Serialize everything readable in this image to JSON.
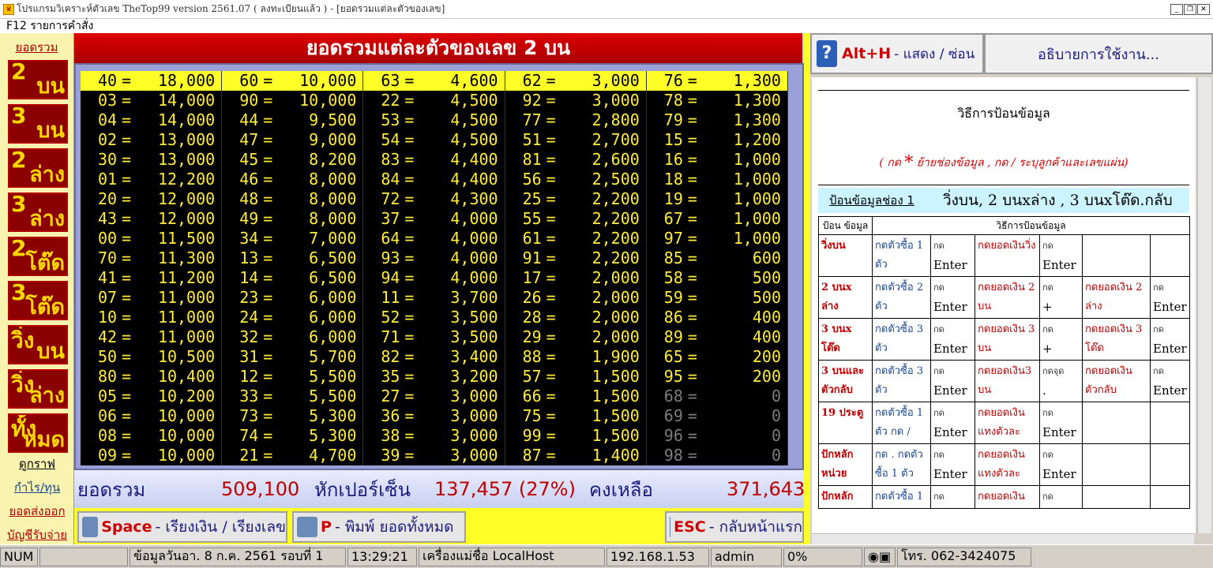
{
  "window": {
    "title": "โปรแกรมวิเคราะห์ตัวเลข TheTop99  version 2561.07  ( ลงทะเบียนแล้ว ) - [ยอดรวมแต่ละตัวของเลข]"
  },
  "menu": {
    "f12": "F12 รายการคำสั่ง"
  },
  "nav": {
    "top": "ยอดรวม",
    "buttons": [
      {
        "num": "2",
        "label": "บน"
      },
      {
        "num": "3",
        "label": "บน"
      },
      {
        "num": "2",
        "label": "ล่าง"
      },
      {
        "num": "3",
        "label": "ล่าง"
      },
      {
        "num": "2",
        "label": "โต๊ด"
      },
      {
        "num": "3",
        "label": "โต๊ด"
      },
      {
        "num": "วิ่ง",
        "label": "บน"
      },
      {
        "num": "วิ่ง",
        "label": "ล่าง"
      },
      {
        "num": "ทั้ง",
        "label": "หมด"
      }
    ],
    "links": [
      "ดูกราฟ",
      "กำไร/ทุน",
      "ยอดส่งออก",
      "บัญชีรับจ่าย"
    ]
  },
  "center": {
    "header": "ยอดรวมแต่ละตัวของเลข 2 บน"
  },
  "grid": {
    "columns": [
      [
        [
          "40",
          "18,000"
        ],
        [
          "03",
          "14,000"
        ],
        [
          "04",
          "14,000"
        ],
        [
          "02",
          "13,000"
        ],
        [
          "30",
          "13,000"
        ],
        [
          "01",
          "12,200"
        ],
        [
          "20",
          "12,000"
        ],
        [
          "43",
          "12,000"
        ],
        [
          "00",
          "11,500"
        ],
        [
          "70",
          "11,300"
        ],
        [
          "41",
          "11,200"
        ],
        [
          "07",
          "11,000"
        ],
        [
          "10",
          "11,000"
        ],
        [
          "42",
          "11,000"
        ],
        [
          "50",
          "10,500"
        ],
        [
          "80",
          "10,400"
        ],
        [
          "05",
          "10,200"
        ],
        [
          "06",
          "10,000"
        ],
        [
          "08",
          "10,000"
        ],
        [
          "09",
          "10,000"
        ]
      ],
      [
        [
          "60",
          "10,000"
        ],
        [
          "90",
          "10,000"
        ],
        [
          "44",
          "9,500"
        ],
        [
          "47",
          "9,000"
        ],
        [
          "45",
          "8,200"
        ],
        [
          "46",
          "8,000"
        ],
        [
          "48",
          "8,000"
        ],
        [
          "49",
          "8,000"
        ],
        [
          "34",
          "7,000"
        ],
        [
          "13",
          "6,500"
        ],
        [
          "14",
          "6,500"
        ],
        [
          "23",
          "6,000"
        ],
        [
          "24",
          "6,000"
        ],
        [
          "32",
          "6,000"
        ],
        [
          "31",
          "5,700"
        ],
        [
          "12",
          "5,500"
        ],
        [
          "33",
          "5,500"
        ],
        [
          "73",
          "5,300"
        ],
        [
          "74",
          "5,300"
        ],
        [
          "21",
          "4,700"
        ]
      ],
      [
        [
          "63",
          "4,600"
        ],
        [
          "22",
          "4,500"
        ],
        [
          "53",
          "4,500"
        ],
        [
          "54",
          "4,500"
        ],
        [
          "83",
          "4,400"
        ],
        [
          "84",
          "4,400"
        ],
        [
          "72",
          "4,300"
        ],
        [
          "37",
          "4,000"
        ],
        [
          "64",
          "4,000"
        ],
        [
          "93",
          "4,000"
        ],
        [
          "94",
          "4,000"
        ],
        [
          "11",
          "3,700"
        ],
        [
          "52",
          "3,500"
        ],
        [
          "71",
          "3,500"
        ],
        [
          "82",
          "3,400"
        ],
        [
          "35",
          "3,200"
        ],
        [
          "27",
          "3,000"
        ],
        [
          "36",
          "3,000"
        ],
        [
          "38",
          "3,000"
        ],
        [
          "39",
          "3,000"
        ]
      ],
      [
        [
          "62",
          "3,000"
        ],
        [
          "92",
          "3,000"
        ],
        [
          "77",
          "2,800"
        ],
        [
          "51",
          "2,700"
        ],
        [
          "81",
          "2,600"
        ],
        [
          "56",
          "2,500"
        ],
        [
          "25",
          "2,200"
        ],
        [
          "55",
          "2,200"
        ],
        [
          "61",
          "2,200"
        ],
        [
          "91",
          "2,200"
        ],
        [
          "17",
          "2,000"
        ],
        [
          "26",
          "2,000"
        ],
        [
          "28",
          "2,000"
        ],
        [
          "29",
          "2,000"
        ],
        [
          "88",
          "1,900"
        ],
        [
          "57",
          "1,500"
        ],
        [
          "66",
          "1,500"
        ],
        [
          "75",
          "1,500"
        ],
        [
          "99",
          "1,500"
        ],
        [
          "87",
          "1,400"
        ]
      ],
      [
        [
          "76",
          "1,300"
        ],
        [
          "78",
          "1,300"
        ],
        [
          "79",
          "1,300"
        ],
        [
          "15",
          "1,200"
        ],
        [
          "16",
          "1,000"
        ],
        [
          "18",
          "1,000"
        ],
        [
          "19",
          "1,000"
        ],
        [
          "67",
          "1,000"
        ],
        [
          "97",
          "1,000"
        ],
        [
          "85",
          "600"
        ],
        [
          "58",
          "500"
        ],
        [
          "59",
          "500"
        ],
        [
          "86",
          "400"
        ],
        [
          "89",
          "400"
        ],
        [
          "65",
          "200"
        ],
        [
          "95",
          "200"
        ],
        [
          "68",
          "0"
        ],
        [
          "69",
          "0"
        ],
        [
          "96",
          "0"
        ],
        [
          "98",
          "0"
        ]
      ]
    ],
    "eq": "="
  },
  "totals": {
    "label_total": "ยอดรวม",
    "total": "509,100",
    "label_deduct": "หักเปอร์เซ็น",
    "deduct": "137,457 (27%)",
    "label_remain": "คงเหลือ",
    "remain": "371,643"
  },
  "bottom": {
    "space_key": "Space",
    "space_desc": "- เรียงเงิน / เรียงเลข",
    "print_key": "P",
    "print_desc": "- พิมพ์ ยอดทั้งหมด",
    "esc_key": "ESC",
    "esc_desc": "- กลับหน้าแรก"
  },
  "help": {
    "alt_key": "Alt+H",
    "alt_desc": "- แสดง / ซ่อน",
    "title": "อธิบายการใช้งาน...",
    "doc_title": "วิธีการป้อนข้อมูล",
    "note_a": "( กด",
    "note_star": "*",
    "note_b": "ย้ายช่องข้อมูล , กด / ระบุลูกค้าและเลขแผ่น)",
    "banner_left": "ป้อนข้อมูลช่อง 1",
    "banner_right": "วิ่งบน, 2 บนxล่าง ,  3 บนxโต๊ด.กลับ",
    "table_head_a": "ป้อน ข้อมูล",
    "table_head_b": "วิธีการป้อนข้อมูล",
    "rows": [
      {
        "name": "วิ่งบน",
        "c1": "กดตัวซื้อ 1 ตัว",
        "c2": "กด",
        "c2e": "Enter",
        "c3": "กดยอดเงินวิ่ง",
        "c4": "กด",
        "c4e": "Enter",
        "c5": "",
        "c6": "",
        "c6e": ""
      },
      {
        "name": "2 บนx ล่าง",
        "c1": "กดตัวซื้อ 2 ตัว",
        "c2": "กด",
        "c2e": "Enter",
        "c3": "กดยอดเงิน 2 บน",
        "c4": "กด",
        "c4e": "+",
        "c5": "กดยอดเงิน 2 ล่าง",
        "c6": "กด",
        "c6e": "Enter"
      },
      {
        "name": "3 บนx โต๊ด",
        "c1": "กดตัวซื้อ 3 ตัว",
        "c2": "กด",
        "c2e": "Enter",
        "c3": "กดยอดเงิน 3 บน",
        "c4": "กด",
        "c4e": "+",
        "c5": "กดยอดเงิน 3 โต๊ด",
        "c6": "กด",
        "c6e": "Enter"
      },
      {
        "name": "3 บนและ ตัวกลับ",
        "c1": "กดตัวซื้อ 3 ตัว",
        "c2": "กด",
        "c2e": "Enter",
        "c3": "กดยอดเงิน3 บน",
        "c4": "กดจุด",
        "c4e": ".",
        "c5": "กดยอดเงิน ตัวกลับ",
        "c6": "กด",
        "c6e": "Enter"
      },
      {
        "name": "19 ประตู",
        "c1": "กดตัวซื้อ 1 ตัว กด /",
        "c2": "กด",
        "c2e": "Enter",
        "c3": "กดยอดเงิน แทงตัวละ",
        "c4": "กด",
        "c4e": "Enter",
        "c5": "",
        "c6": "",
        "c6e": ""
      },
      {
        "name": "ปักหลัก หน่วย",
        "c1": "กด . กดตัว ซื้อ 1 ตัว",
        "c2": "กด",
        "c2e": "Enter",
        "c3": "กดยอดเงิน แทงตัวละ",
        "c4": "กด",
        "c4e": "Enter",
        "c5": "",
        "c6": "",
        "c6e": ""
      },
      {
        "name": "ปักหลัก",
        "c1": "กดตัวซื้อ 1",
        "c2": "กด",
        "c2e": "",
        "c3": "กดยอดเงิน",
        "c4": "กด",
        "c4e": "",
        "c5": "",
        "c6": "",
        "c6e": ""
      }
    ]
  },
  "status": {
    "num": "NUM",
    "date": "ข้อมูลวันอา. 8 ก.ค. 2561 รอบที่ 1",
    "time": "13:29:21",
    "host": "เครื่องแม่ชื่อ LocalHost",
    "ip": "192.168.1.53",
    "user": "admin",
    "pct": "0%",
    "phone": "โทร. 062-3424075"
  },
  "colors": {
    "accent_red": "#c00000",
    "grid_bg": "#000000",
    "grid_text": "#ffec3a",
    "highlight": "#ffff28"
  }
}
